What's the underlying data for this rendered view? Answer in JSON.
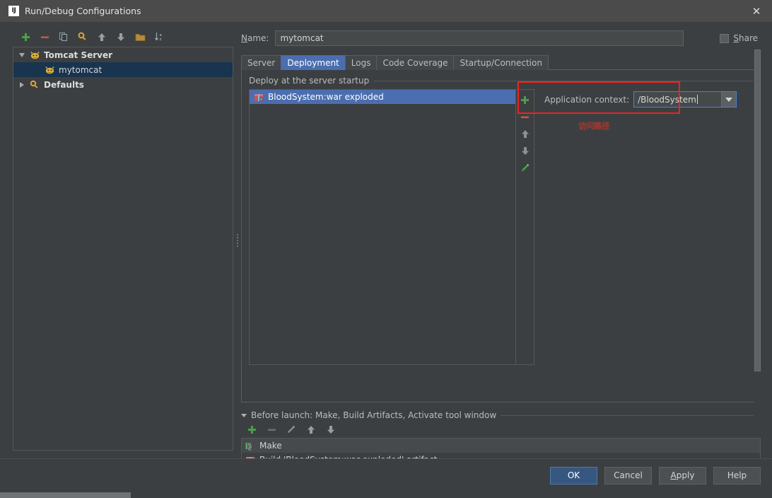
{
  "window": {
    "title": "Run/Debug Configurations",
    "logo_text": "IJ",
    "close_label": "✕"
  },
  "left_panel": {
    "toolbar": [
      {
        "name": "add-configuration-button",
        "icon": "plus-icon",
        "tooltip": "Add New Configuration"
      },
      {
        "name": "remove-configuration-button",
        "icon": "minus-icon",
        "tooltip": "Remove Configuration"
      },
      {
        "name": "copy-configuration-button",
        "icon": "copy-icon",
        "tooltip": "Copy Configuration"
      },
      {
        "name": "save-configuration-button",
        "icon": "save-wrench-icon",
        "tooltip": "Save Configuration"
      },
      {
        "name": "move-up-button",
        "icon": "arrow-up-icon",
        "tooltip": "Move Up"
      },
      {
        "name": "move-down-button",
        "icon": "arrow-down-icon",
        "tooltip": "Move Down"
      },
      {
        "name": "create-folder-button",
        "icon": "folder-icon",
        "tooltip": "Create New Folder"
      },
      {
        "name": "sort-button",
        "icon": "sort-az-icon",
        "tooltip": "Sort Configurations"
      }
    ],
    "tree": [
      {
        "label": "Tomcat Server",
        "icon": "tomcat-icon",
        "expanded": true,
        "level": 0,
        "selected": false,
        "bold": true
      },
      {
        "label": "mytomcat",
        "icon": "tomcat-icon",
        "expanded": null,
        "level": 1,
        "selected": true,
        "bold": false
      },
      {
        "label": "Defaults",
        "icon": "defaults-icon",
        "expanded": false,
        "level": 0,
        "selected": false,
        "bold": true
      }
    ]
  },
  "config": {
    "name_label": "Name:",
    "name_label_mnemonic": "N",
    "name_value": "mytomcat",
    "name_placeholder": "",
    "share": {
      "label": "Share",
      "mnemonic": "S",
      "checked": false
    },
    "tabs": [
      {
        "label": "Server",
        "active": false
      },
      {
        "label": "Deployment",
        "active": true
      },
      {
        "label": "Logs",
        "active": false
      },
      {
        "label": "Code Coverage",
        "active": false
      },
      {
        "label": "Startup/Connection",
        "active": false
      }
    ],
    "deployment": {
      "group_title": "Deploy at the server startup",
      "artifacts": [
        {
          "label": "BloodSystem:war exploded",
          "icon": "artifact-icon",
          "selected": true
        }
      ],
      "list_actions": [
        {
          "name": "add-artifact-button",
          "icon": "plus-icon"
        },
        {
          "name": "remove-artifact-button",
          "icon": "minus-icon"
        },
        {
          "name": "artifact-move-up-button",
          "icon": "arrow-up-icon"
        },
        {
          "name": "artifact-move-down-button",
          "icon": "arrow-down-icon"
        },
        {
          "name": "edit-artifact-button",
          "icon": "pencil-icon"
        }
      ],
      "application_context_label": "Application context:",
      "application_context_value": "/BloodSystem",
      "annotation_note": "访问路径"
    },
    "before_launch": {
      "header": "Before launch: Make, Build Artifacts, Activate tool window",
      "toolbar": [
        {
          "name": "add-task-button",
          "icon": "plus-icon"
        },
        {
          "name": "remove-task-button",
          "icon": "minus-icon"
        },
        {
          "name": "edit-task-button",
          "icon": "pencil-icon"
        },
        {
          "name": "task-move-up-button",
          "icon": "arrow-up-icon"
        },
        {
          "name": "task-move-down-button",
          "icon": "arrow-down-icon"
        }
      ],
      "tasks": [
        {
          "label": "Make",
          "icon": "make-icon"
        },
        {
          "label": "Build 'BloodSystem:war exploded' artifact",
          "icon": "artifact-icon"
        }
      ]
    }
  },
  "footer": {
    "ok": "OK",
    "cancel": "Cancel",
    "apply": "Apply",
    "apply_mnemonic": "A",
    "help": "Help"
  },
  "colors": {
    "background": "#3c3f41",
    "titlebar": "#4b4b4b",
    "selection_blue": "#4b6eaf",
    "tree_selection": "#18344f",
    "accent_green": "#4c9e4c",
    "accent_red": "#c75450",
    "annotation_red": "#ee2222",
    "focus_border": "#4b81d4",
    "default_button": "#365880"
  }
}
